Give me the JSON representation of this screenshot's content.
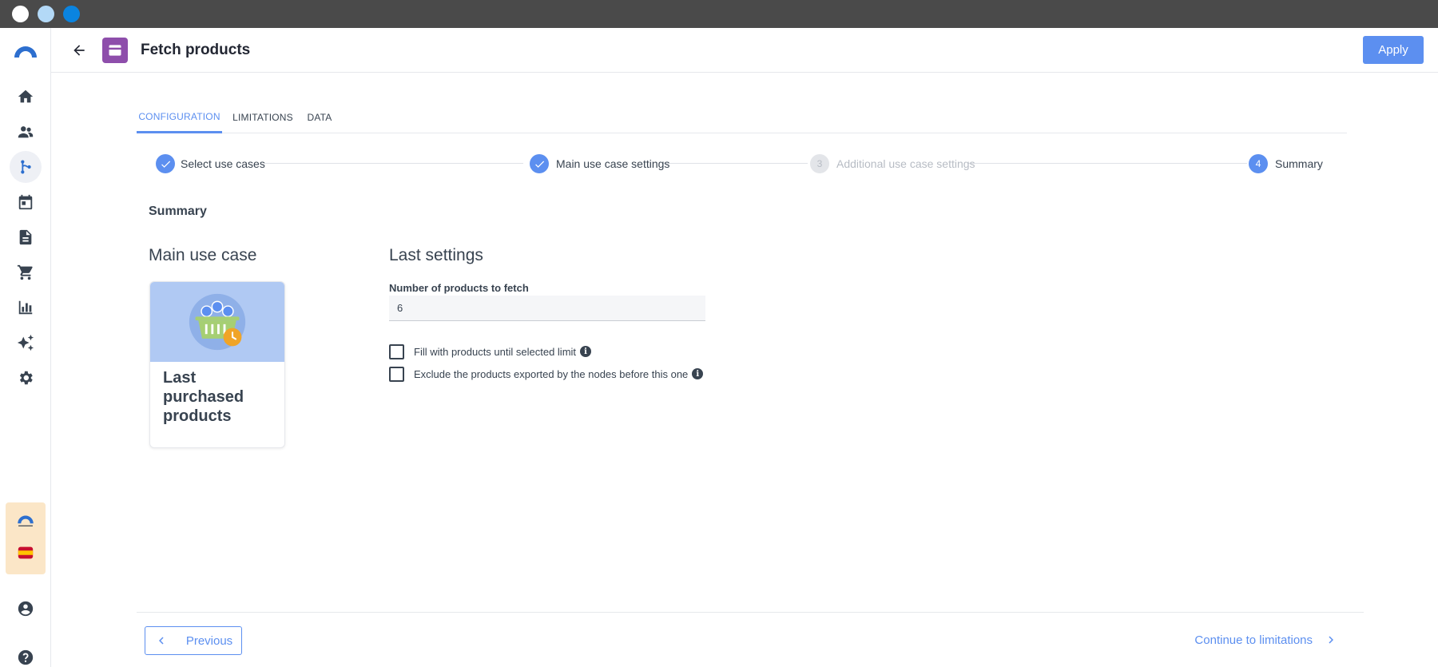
{
  "window": {
    "dots": [
      {
        "color": "#ffffff"
      },
      {
        "color": "#b3d9f7"
      },
      {
        "color": "#0a84e0"
      }
    ]
  },
  "sidebar": {
    "items": [
      {
        "icon": "home-icon"
      },
      {
        "icon": "people-icon"
      },
      {
        "icon": "workflow-icon",
        "active": true
      },
      {
        "icon": "calendar-icon"
      },
      {
        "icon": "document-icon"
      },
      {
        "icon": "cart-icon"
      },
      {
        "icon": "chart-icon"
      },
      {
        "icon": "sparkle-icon"
      },
      {
        "icon": "gear-icon"
      }
    ],
    "bottom": [
      {
        "icon": "account-icon"
      },
      {
        "icon": "help-icon"
      }
    ]
  },
  "header": {
    "title": "Fetch products",
    "apply_label": "Apply"
  },
  "tabs": [
    {
      "label": "CONFIGURATION",
      "active": true
    },
    {
      "label": "LIMITATIONS",
      "active": false
    },
    {
      "label": "DATA",
      "active": false
    }
  ],
  "stepper": {
    "steps": [
      {
        "number": "1",
        "label": "Select use cases",
        "state": "done"
      },
      {
        "number": "2",
        "label": "Main use case settings",
        "state": "done"
      },
      {
        "number": "3",
        "label": "Additional use case settings",
        "state": "todo"
      },
      {
        "number": "4",
        "label": "Summary",
        "state": "current"
      }
    ]
  },
  "summary": {
    "title": "Summary",
    "main_use_case_heading": "Main use case",
    "use_case_card_label": "Last purchased products",
    "last_settings_heading": "Last settings",
    "number_field_label": "Number of products to fetch",
    "number_field_value": "6",
    "fill_checkbox_label": "Fill with products until selected limit",
    "fill_checked": false,
    "exclude_checkbox_label": "Exclude the products exported by the nodes before this one",
    "exclude_checked": false
  },
  "footer": {
    "previous_label": "Previous",
    "continue_label": "Continue to limitations"
  },
  "colors": {
    "accent": "#5c8ff0",
    "node_icon": "#8e4eab",
    "card_top": "#b0c9f3",
    "workspace_bg": "#fbe6c7"
  }
}
